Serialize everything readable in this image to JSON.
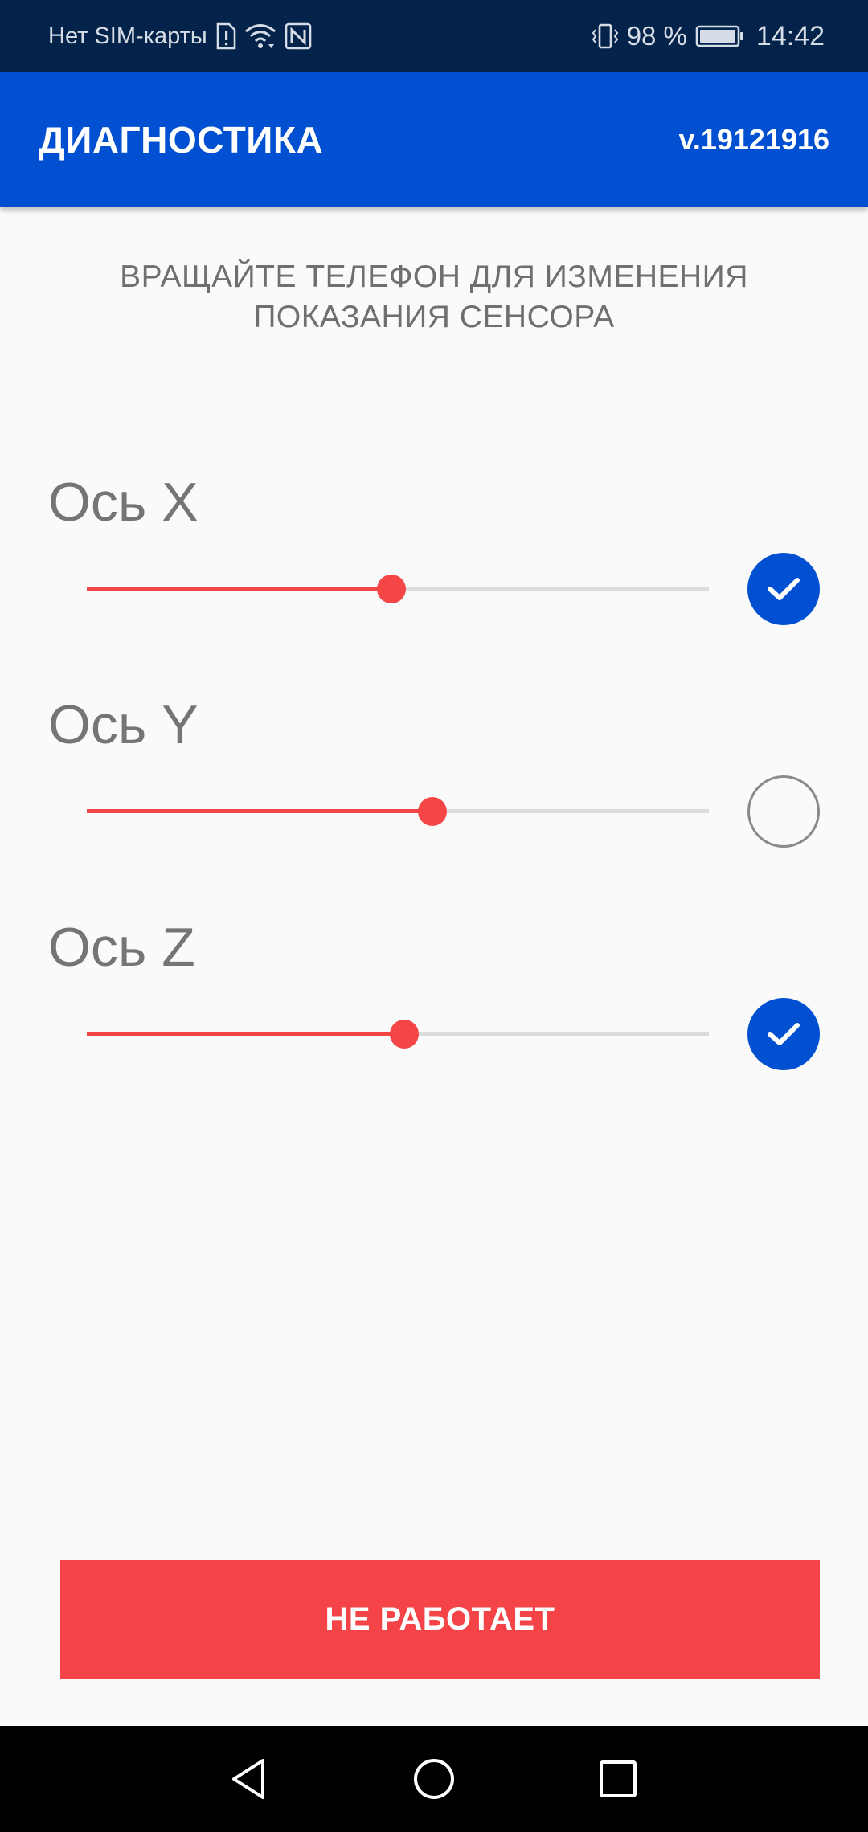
{
  "status_bar": {
    "carrier": "Нет SIM-карты",
    "battery_percent": "98 %",
    "time": "14:42",
    "icons": [
      "sim-alert-icon",
      "wifi-icon",
      "nfc-icon",
      "vibrate-icon",
      "battery-icon"
    ]
  },
  "app_bar": {
    "title": "ДИАГНОСТИКА",
    "version": "v.19121916",
    "color": "#0050d1"
  },
  "instruction": {
    "line1": "ВРАЩАЙТЕ ТЕЛЕФОН ДЛЯ ИЗМЕНЕНИЯ",
    "line2": "ПОКАЗАНИЯ СЕНСОРА"
  },
  "axes": [
    {
      "label": "Ось X",
      "value": 0.49,
      "checked": true
    },
    {
      "label": "Ось Y",
      "value": 0.555,
      "checked": false
    },
    {
      "label": "Ось Z",
      "value": 0.51,
      "checked": true
    }
  ],
  "slider_color": "#f44646",
  "button": {
    "label": "НЕ РАБОТАЕТ",
    "color": "#f44448"
  },
  "nav_bar": {
    "icons": [
      "back-icon",
      "home-icon",
      "recents-icon"
    ]
  }
}
